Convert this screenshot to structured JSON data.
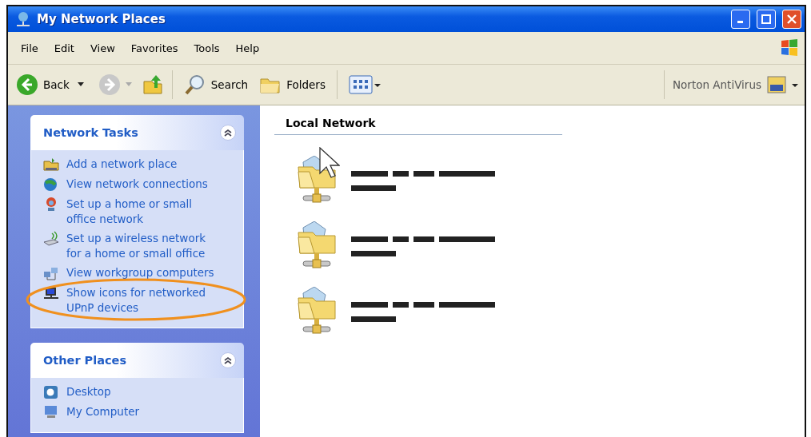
{
  "window": {
    "title": "My Network Places"
  },
  "menu": [
    "File",
    "Edit",
    "View",
    "Favorites",
    "Tools",
    "Help"
  ],
  "toolbar": {
    "back": "Back",
    "search": "Search",
    "folders": "Folders",
    "norton": "Norton AntiVirus"
  },
  "sidebar": {
    "panels": [
      {
        "title": "Network Tasks",
        "expanded": true,
        "items": [
          {
            "kind": "add-place",
            "label": "Add a network place",
            "highlighted": false
          },
          {
            "kind": "connections",
            "label": "View network connections",
            "highlighted": false
          },
          {
            "kind": "home-network",
            "label": "Set up a home or small office network",
            "highlighted": false
          },
          {
            "kind": "wireless",
            "label": "Set up a wireless network for a home or small office",
            "highlighted": false
          },
          {
            "kind": "workgroup",
            "label": "View workgroup computers",
            "highlighted": false
          },
          {
            "kind": "upnp",
            "label": "Show icons for networked UPnP devices",
            "highlighted": true
          }
        ]
      },
      {
        "title": "Other Places",
        "expanded": true,
        "items": [
          {
            "kind": "desktop",
            "label": "Desktop",
            "highlighted": false
          },
          {
            "kind": "computer",
            "label": "My Computer",
            "highlighted": false
          }
        ]
      }
    ]
  },
  "main": {
    "group": "Local Network",
    "shares": [
      {
        "kind": "network-folder"
      },
      {
        "kind": "network-folder"
      },
      {
        "kind": "network-folder"
      }
    ]
  }
}
